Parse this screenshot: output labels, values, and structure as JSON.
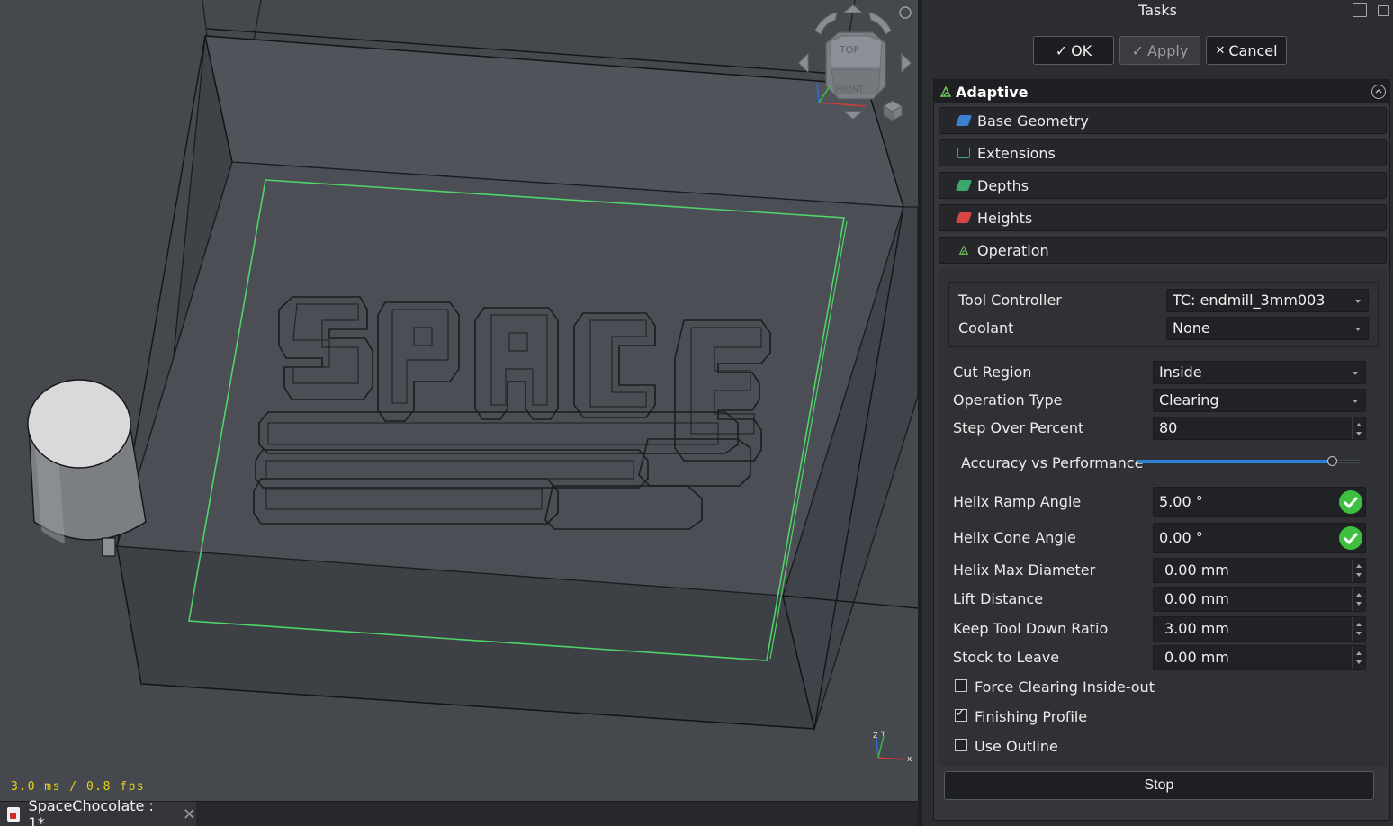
{
  "viewport": {
    "fps_text": "3.0 ms / 0.8 fps",
    "navcube": {
      "top_label": "TOP",
      "front_label": "FRONT"
    },
    "axis_labels": {
      "x": "x",
      "y": "Y",
      "z": "Z"
    }
  },
  "document_tab": {
    "label": "SpaceChocolate : 1*",
    "close_glyph": "✕"
  },
  "panel": {
    "title": "Tasks",
    "buttons": {
      "ok": "OK",
      "apply": "Apply",
      "cancel": "Cancel",
      "ok_glyph": "✓",
      "apply_glyph": "✓",
      "cancel_glyph": "✕"
    },
    "task_header": "Adaptive",
    "sections": [
      {
        "label": "Base Geometry",
        "icon": "base-geometry-icon",
        "color": "#3d7fd1"
      },
      {
        "label": "Extensions",
        "icon": "extensions-icon",
        "color": "#2fa6a6"
      },
      {
        "label": "Depths",
        "icon": "depths-icon",
        "color": "#3aa86a"
      },
      {
        "label": "Heights",
        "icon": "heights-icon",
        "color": "#d94545"
      },
      {
        "label": "Operation",
        "icon": "operation-icon",
        "color": "#6fc35b"
      }
    ],
    "operation": {
      "tool_controller": {
        "label": "Tool Controller",
        "value": "TC: endmill_3mm003"
      },
      "coolant": {
        "label": "Coolant",
        "value": "None"
      },
      "cut_region": {
        "label": "Cut Region",
        "value": "Inside"
      },
      "operation_type": {
        "label": "Operation Type",
        "value": "Clearing"
      },
      "step_over": {
        "label": "Step Over Percent",
        "value": "80"
      },
      "accuracy": {
        "label": "Accuracy vs Performance",
        "fraction": 0.88
      },
      "helix_ramp": {
        "label": "Helix Ramp Angle",
        "value": "5.00 °"
      },
      "helix_cone": {
        "label": "Helix Cone Angle",
        "value": "0.00 °"
      },
      "helix_max_diameter": {
        "label": "Helix Max Diameter",
        "value": "0.00 mm"
      },
      "lift_distance": {
        "label": "Lift Distance",
        "value": "0.00 mm"
      },
      "keep_tool_down": {
        "label": "Keep Tool Down Ratio",
        "value": "3.00 mm"
      },
      "stock_to_leave": {
        "label": "Stock to Leave",
        "value": "0.00 mm"
      },
      "force_clearing": {
        "label": "Force Clearing Inside-out",
        "checked": false
      },
      "finishing_profile": {
        "label": "Finishing Profile",
        "checked": true
      },
      "use_outline": {
        "label": "Use Outline",
        "checked": false
      },
      "stop": "Stop"
    }
  },
  "colors": {
    "accent": "#2a83d6",
    "ok_green": "#3fbf3f",
    "selection_green": "#4fd46a",
    "fps_yellow": "#e8d21c"
  }
}
